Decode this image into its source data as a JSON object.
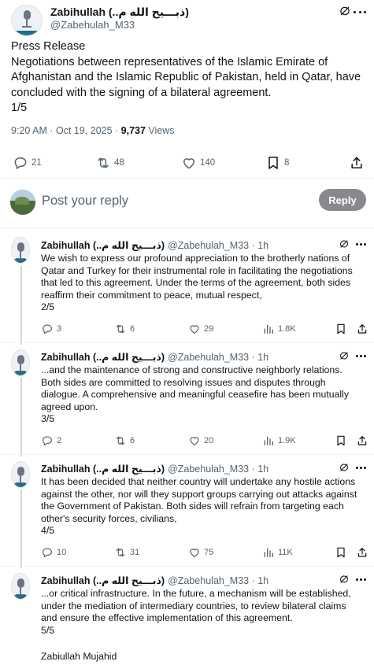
{
  "main_tweet": {
    "author_name": "Zabihullah (..ذبـــیح الله م)",
    "author_handle": "@Zabehulah_M33",
    "lines": [
      "Press Release",
      "Negotiations between representatives of the Islamic Emirate of Afghanistan and the Islamic Republic of Pakistan, held in Qatar, have concluded with the signing of a bilateral agreement.",
      "1/5"
    ],
    "timestamp": "9:20 AM · Oct 19, 2025 · ",
    "views_count": "9,737",
    "views_label": " Views",
    "stats": {
      "replies": "21",
      "reposts": "48",
      "likes": "140",
      "bookmarks": "8"
    }
  },
  "reply_box": {
    "placeholder": "Post your reply",
    "button_label": "Reply"
  },
  "thread": [
    {
      "author_name": "Zabihullah (..ذبـــیح الله م)",
      "handle_time": "@Zabehulah_M33 · 1h",
      "text": "We wish to express our profound appreciation to the brotherly nations of Qatar and Turkey for their instrumental role in facilitating the negotiations that led to this agreement. Under the terms of the agreement, both sides reaffirm their commitment to peace, mutual respect,",
      "part": "2/5",
      "replies": "3",
      "reposts": "6",
      "likes": "29",
      "views": "1.8K"
    },
    {
      "author_name": "Zabihullah (..ذبـــیح الله م)",
      "handle_time": "@Zabehulah_M33 · 1h",
      "text": "...and the maintenance of strong and constructive neighborly relations. Both sides are committed to resolving issues and disputes through dialogue. A comprehensive and meaningful ceasefire has been mutually agreed upon.",
      "part": "3/5",
      "replies": "2",
      "reposts": "6",
      "likes": "20",
      "views": "1.9K"
    },
    {
      "author_name": "Zabihullah (..ذبـــیح الله م)",
      "handle_time": "@Zabehulah_M33 · 1h",
      "text": "It has been decided that neither country will undertake any hostile actions against the other, nor will they support groups carrying out attacks against the Government of Pakistan. Both sides will refrain from targeting each other's security forces, civilians,",
      "part": "4/5",
      "replies": "10",
      "reposts": "31",
      "likes": "75",
      "views": "11K"
    },
    {
      "author_name": "Zabihullah (..ذبـــیح الله م)",
      "handle_time": "@Zabehulah_M33 · 1h",
      "text": "...or critical infrastructure. In the future, a mechanism will be established, under the mediation of intermediary countries, to review bilateral claims and ensure the effective implementation of this agreement.",
      "part": "5/5",
      "signature": "Zabiullah Mujahid"
    }
  ],
  "icons": {
    "grok": "grok-icon",
    "more": "more-icon",
    "reply": "reply-icon",
    "repost": "repost-icon",
    "like": "like-icon",
    "views": "views-icon",
    "bookmark": "bookmark-icon",
    "share": "share-icon"
  },
  "colors": {
    "text": "#0f1419",
    "secondary": "#536471",
    "divider": "#eff3f4",
    "reply_button": "#87898c"
  }
}
